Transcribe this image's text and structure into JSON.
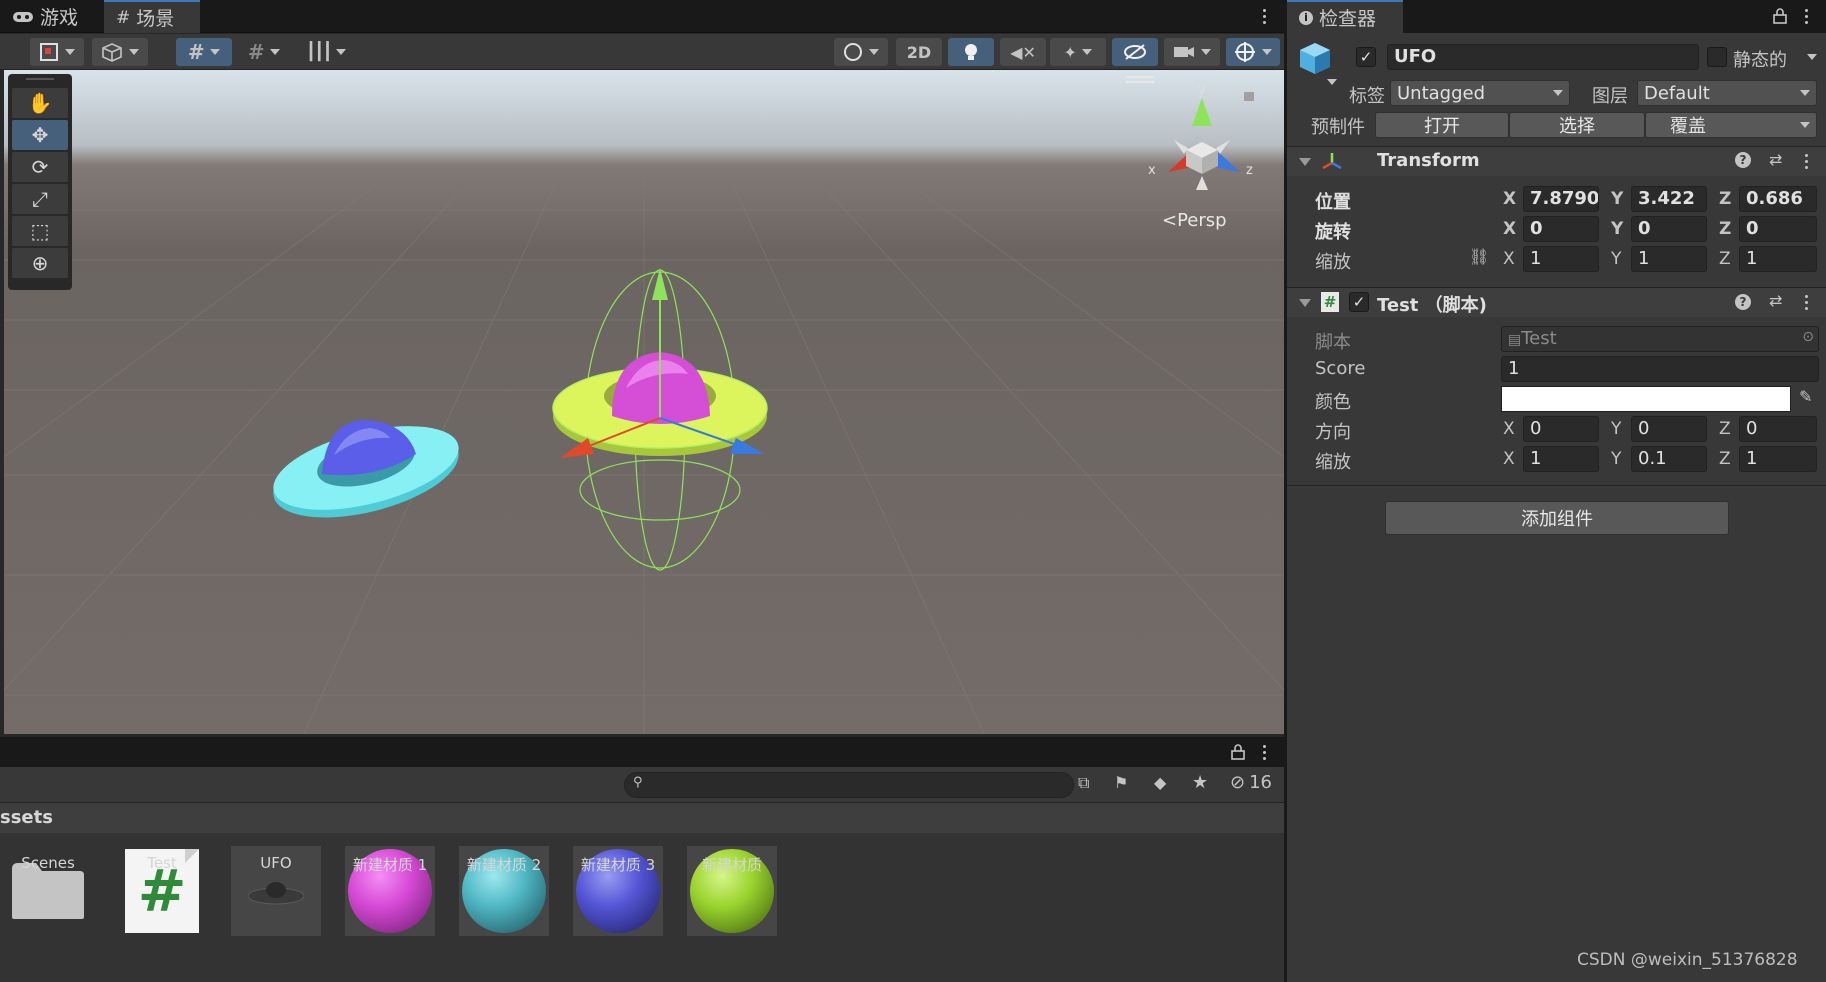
{
  "scene_tabs": [
    {
      "icon": "game-controller-icon",
      "label": "游戏"
    },
    {
      "icon": "grid-icon",
      "label": "场景"
    }
  ],
  "toolbar": {
    "mode_2d": "2D"
  },
  "viewport": {
    "camera_label": "Persp",
    "gizmo_axes": {
      "x": "x",
      "y": "y",
      "z": "z"
    },
    "objects": [
      {
        "name": "cyan-ufo",
        "disc_color": "#6fe6ee",
        "dome_color": "#5a5ee0"
      },
      {
        "name": "selected-ufo",
        "disc_color": "#d9f25a",
        "dome_color": "#d649d6"
      }
    ]
  },
  "tools": [
    "hand",
    "move",
    "rotate",
    "scale",
    "rect",
    "transform"
  ],
  "project": {
    "hidden_count": "16",
    "search_placeholder": "",
    "assets_header": "ssets",
    "assets": [
      {
        "type": "folder",
        "label": "Scenes"
      },
      {
        "type": "script",
        "label": "Test"
      },
      {
        "type": "prefab",
        "label": "UFO"
      },
      {
        "type": "material",
        "label": "新建材质 1",
        "color": "#d64ad6"
      },
      {
        "type": "material",
        "label": "新建材质 2",
        "color": "#4fb8c4"
      },
      {
        "type": "material",
        "label": "新建材质 3",
        "color": "#5456d6"
      },
      {
        "type": "material",
        "label": "新建材质",
        "color": "#9ad42e"
      }
    ]
  },
  "inspector": {
    "tab_label": "检查器",
    "object_name": "UFO",
    "static_label": "静态的",
    "tag_label": "标签",
    "tag_value": "Untagged",
    "layer_label": "图层",
    "layer_value": "Default",
    "prefab_label": "预制件",
    "prefab_open": "打开",
    "prefab_select": "选择",
    "prefab_overrides": "覆盖",
    "transform": {
      "title": "Transform",
      "position_label": "位置",
      "rotation_label": "旋转",
      "scale_label": "缩放",
      "position": {
        "x": "7.87901",
        "y": "3.422",
        "z": "0.686"
      },
      "rotation": {
        "x": "0",
        "y": "0",
        "z": "0"
      },
      "scale": {
        "x": "1",
        "y": "1",
        "z": "1"
      }
    },
    "script_component": {
      "title": "Test （脚本)",
      "script_label": "脚本",
      "script_value": "Test",
      "score_label": "Score",
      "score_value": "1",
      "color_label": "颜色",
      "color_value": "#ffffff",
      "direction_label": "方向",
      "direction": {
        "x": "0",
        "y": "0",
        "z": "0"
      },
      "scale_label": "缩放",
      "scale": {
        "x": "1",
        "y": "0.1",
        "z": "1"
      }
    },
    "add_component": "添加组件"
  },
  "watermark": "CSDN @weixin_51376828"
}
